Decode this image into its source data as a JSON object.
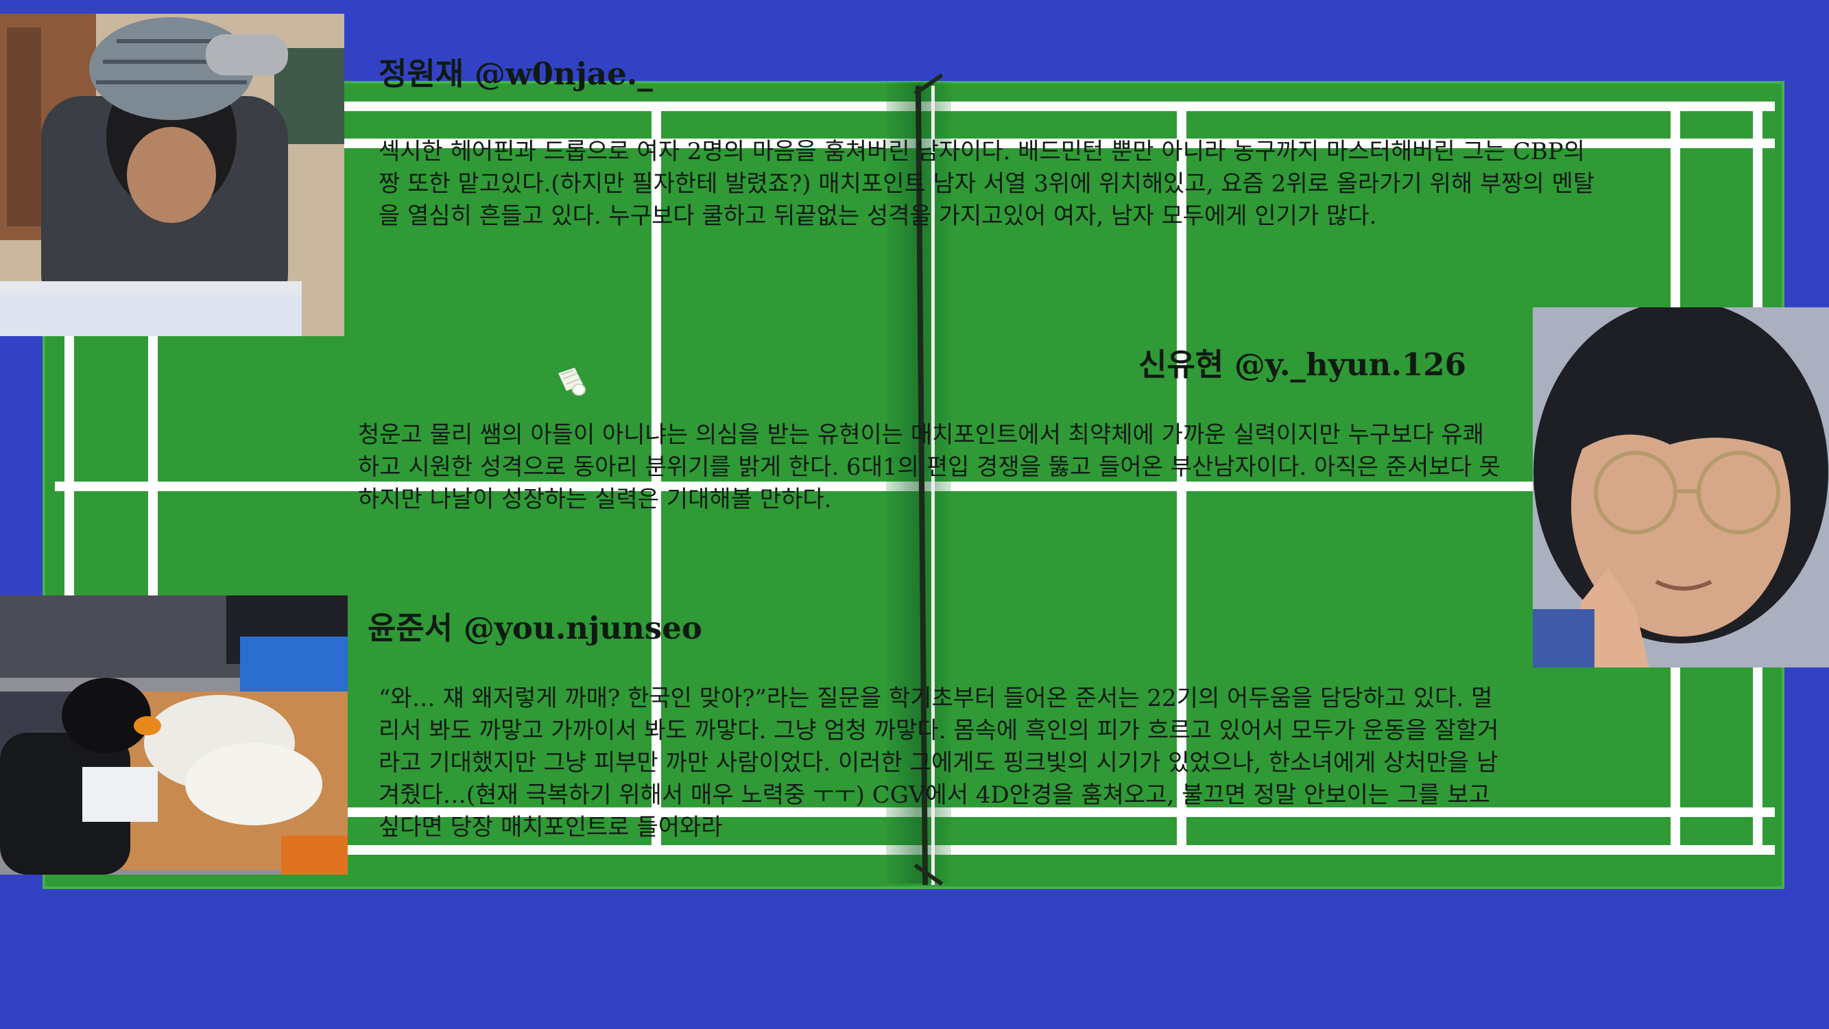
{
  "members": [
    {
      "name": "정원재",
      "handle": "@w0njae._",
      "bio": "섹시한 헤어핀과 드롭으로 여자 2명의 마음을 훔쳐버린 남자이다. 배드민턴 뿐만 아니라 농구까지 마스터해버린 그는 CBP의 짱 또한 맡고있다.(하지만 필자한테 발렸죠?) 매치포인트 남자 서열 3위에 위치해있고, 요즘 2위로 올라가기 위해 부짱의 멘탈을 열심히 흔들고 있다. 누구보다 쿨하고 뒤끝없는 성격을 가지고있어 여자, 남자 모두에게 인기가 많다."
    },
    {
      "name": "신유현",
      "handle": "@y._hyun.126",
      "bio": "청운고 물리 쌤의 아들이 아니냐는 의심을 받는 유현이는 매치포인트에서 최약체에 가까운 실력이지만 누구보다 유쾌하고 시원한 성격으로 동아리 분위기를 밝게 한다. 6대1의 편입 경쟁을 뚫고 들어온 부산남자이다. 아직은 준서보다 못하지만 나날이 성장하는 실력은 기대해볼 만하다."
    },
    {
      "name": "윤준서",
      "handle": "@you.njunseo",
      "bio": "“와… 쟤 왜저렇게 까매? 한국인 맞아?”라는 질문을 학기초부터 들어온 준서는 22기의 어두움을 담당하고 있다. 멀리서 봐도 까맣고 가까이서 봐도 까맣다. 그냥 엄청 까맣다. 몸속에 흑인의 피가 흐르고 있어서 모두가 운동을 잘할거라고 기대했지만 그냥 피부만 까만 사람이었다. 이러한 그에게도 핑크빛의 시기가 있었으나, 한소녀에게 상처만을 남겨줬다…(현재 극복하기 위해서 매우 노력중 ㅜㅜ) CGV에서 4D안경을 훔쳐오고, 불끄면 정말 안보이는 그를 보고싶다면 당장 매치포인트로 들어와라"
    }
  ],
  "colors": {
    "background": "#3342c4",
    "court": "#2f9a36",
    "lines": "#ffffff",
    "text": "#111a14"
  }
}
